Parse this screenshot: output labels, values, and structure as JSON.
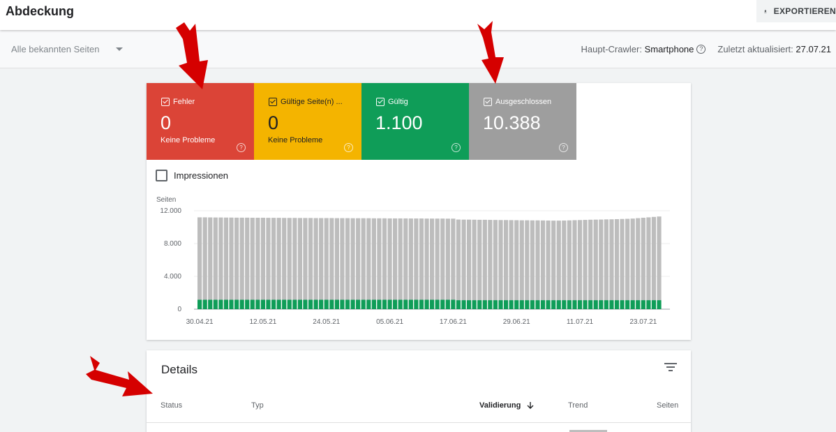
{
  "header": {
    "title": "Abdeckung",
    "export_label": "EXPORTIEREN"
  },
  "filter": {
    "selected": "Alle bekannten Seiten"
  },
  "crawler": {
    "label": "Haupt-Crawler:",
    "value": "Smartphone",
    "updated_label": "Zuletzt aktualisiert:",
    "updated_value": "27.07.21"
  },
  "tiles": [
    {
      "label": "Fehler",
      "value": "0",
      "sub": "Keine Probleme",
      "color": "#db4437"
    },
    {
      "label": "Gültige Seite(n) ...",
      "value": "0",
      "sub": "Keine Probleme",
      "color": "#f4b400"
    },
    {
      "label": "Gültig",
      "value": "1.100",
      "sub": "",
      "color": "#0f9d58"
    },
    {
      "label": "Ausgeschlossen",
      "value": "10.388",
      "sub": "",
      "color": "#9e9e9e"
    }
  ],
  "impressions_label": "Impressionen",
  "colors": {
    "excluded": "#bdbdbd",
    "valid": "#0f9d58",
    "annotation_arrow": "#d50000"
  },
  "chart_data": {
    "type": "bar",
    "stacked": true,
    "ylabel": "Seiten",
    "ylim": [
      0,
      12000
    ],
    "y_ticks": [
      "0",
      "4.000",
      "8.000",
      "12.000"
    ],
    "y_tick_values": [
      0,
      4000,
      8000,
      12000
    ],
    "x_tick_labels": [
      "30.04.21",
      "12.05.21",
      "24.05.21",
      "05.06.21",
      "17.06.21",
      "29.06.21",
      "11.07.21",
      "23.07.21"
    ],
    "x_tick_indices": [
      0,
      12,
      24,
      36,
      48,
      60,
      72,
      84
    ],
    "series": [
      {
        "color": "#0f9d58",
        "values": [
          1150,
          1150,
          1150,
          1150,
          1150,
          1150,
          1150,
          1150,
          1150,
          1150,
          1150,
          1150,
          1150,
          1150,
          1150,
          1150,
          1150,
          1150,
          1150,
          1150,
          1150,
          1150,
          1150,
          1150,
          1150,
          1150,
          1150,
          1150,
          1150,
          1150,
          1150,
          1150,
          1150,
          1150,
          1150,
          1150,
          1150,
          1150,
          1150,
          1150,
          1150,
          1150,
          1150,
          1150,
          1150,
          1150,
          1150,
          1150,
          1150,
          1100,
          1100,
          1100,
          1100,
          1100,
          1100,
          1100,
          1100,
          1100,
          1100,
          1100,
          1100,
          1100,
          1100,
          1100,
          1100,
          1100,
          1100,
          1100,
          1100,
          1100,
          1100,
          1100,
          1100,
          1100,
          1100,
          1100,
          1100,
          1100,
          1100,
          1100,
          1100,
          1100,
          1100,
          1100,
          1100,
          1100,
          1100,
          1100
        ]
      },
      {
        "color": "#bdbdbd",
        "values": [
          10050,
          10050,
          10040,
          10030,
          10030,
          10020,
          10020,
          10010,
          10010,
          10010,
          10000,
          10000,
          10000,
          9990,
          9990,
          9990,
          9980,
          9980,
          9980,
          9970,
          9970,
          9970,
          9960,
          9960,
          9960,
          9960,
          9950,
          9950,
          9950,
          9940,
          9940,
          9940,
          9940,
          9930,
          9930,
          9930,
          9920,
          9920,
          9920,
          9920,
          9910,
          9910,
          9910,
          9900,
          9900,
          9900,
          9900,
          9890,
          9890,
          9830,
          9820,
          9820,
          9810,
          9800,
          9800,
          9790,
          9780,
          9770,
          9770,
          9760,
          9750,
          9740,
          9740,
          9730,
          9730,
          9720,
          9710,
          9700,
          9700,
          9710,
          9730,
          9750,
          9770,
          9790,
          9810,
          9820,
          9830,
          9850,
          9860,
          9880,
          9900,
          9920,
          9950,
          10000,
          10050,
          10100,
          10150,
          10200
        ]
      }
    ]
  },
  "details": {
    "title": "Details",
    "columns": [
      "Status",
      "Typ",
      "Validierung",
      "Trend",
      "Seiten"
    ]
  }
}
